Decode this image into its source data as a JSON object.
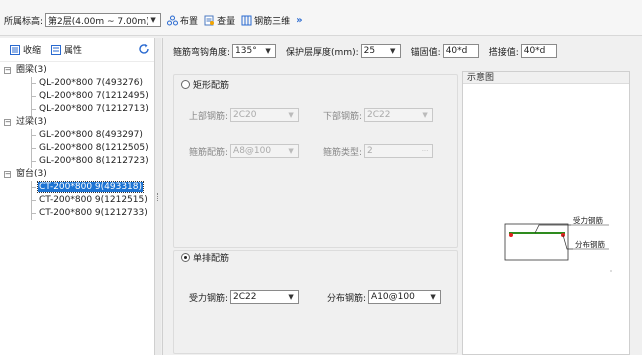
{
  "toolbar": {
    "floor_label": "所属标高:",
    "floor_value": "第2层(4.00m ~ 7.00m)",
    "layout_label": "布置",
    "check_label": "查量",
    "rebar3d_label": "钢筋三维",
    "more_label": "»"
  },
  "left_panel": {
    "tab_collapse": "收缩",
    "tab_properties": "属性",
    "groups": [
      {
        "label": "圈梁(3)",
        "items": [
          "QL-200*800 7(493276)",
          "QL-200*800 7(1212495)",
          "QL-200*800 7(1212713)"
        ]
      },
      {
        "label": "过梁(3)",
        "items": [
          "GL-200*800 8(493297)",
          "GL-200*800 8(1212505)",
          "GL-200*800 8(1212723)"
        ]
      },
      {
        "label": "窗台(3)",
        "items": [
          "CT-200*800 9(493318)",
          "CT-200*800 9(1212515)",
          "CT-200*800 9(1212733)"
        ]
      }
    ],
    "selected_item": "CT-200*800 9(493318)"
  },
  "params": {
    "hook_angle_label": "箍筋弯钩角度:",
    "hook_angle_value": "135°",
    "cover_label": "保护层厚度(mm):",
    "cover_value": "25",
    "anchor_label": "锚固值:",
    "anchor_value": "40*d",
    "lap_label": "搭接值:",
    "lap_value": "40*d"
  },
  "rect_rebar": {
    "radio_label": "矩形配筋",
    "top_label": "上部钢筋:",
    "top_value": "2C20",
    "bottom_label": "下部钢筋:",
    "bottom_value": "2C22",
    "stirrup_label": "箍筋配筋:",
    "stirrup_value": "A8@100",
    "stirrup_type_label": "箍筋类型:",
    "stirrup_type_value": "2",
    "stirrup_type_btn": "···"
  },
  "single_rebar": {
    "radio_label": "单排配筋",
    "main_label": "受力钢筋:",
    "main_value": "2C22",
    "dist_label": "分布钢筋:",
    "dist_value": "A10@100"
  },
  "preview": {
    "title": "示意图",
    "main_rebar_label": "受力钢筋",
    "dist_rebar_label": "分布钢筋"
  },
  "colors": {
    "selection": "#1e74d3",
    "rebar_main": "#2e8b1e",
    "rebar_dot": "#e02020",
    "accent": "#2a6ad0"
  }
}
